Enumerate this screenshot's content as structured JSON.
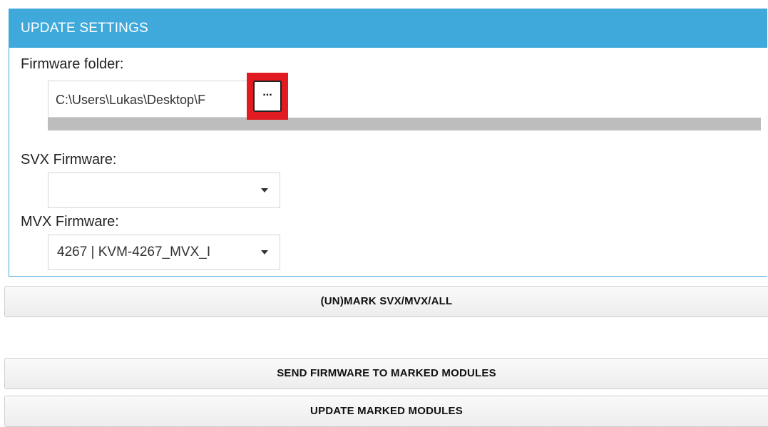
{
  "panel": {
    "title": "UPDATE SETTINGS"
  },
  "firmware_folder": {
    "label": "Firmware folder:",
    "value": "C:\\Users\\Lukas\\Desktop\\F",
    "browse_label": "...",
    "progress": 0
  },
  "svx_firmware": {
    "label": "SVX Firmware:",
    "selected": ""
  },
  "mvx_firmware": {
    "label": "MVX Firmware:",
    "selected": "4267 | KVM-4267_MVX_I"
  },
  "buttons": {
    "mark_label": "(UN)MARK SVX/MVX/ALL",
    "send_label": "SEND FIRMWARE TO MARKED MODULES",
    "update_label": "UPDATE MARKED MODULES"
  },
  "colors": {
    "accent": "#3fa9db",
    "highlight": "#e21b23",
    "progress_track": "#bdbdbd"
  },
  "icons": {
    "dropdown": "chevron-down-icon"
  }
}
